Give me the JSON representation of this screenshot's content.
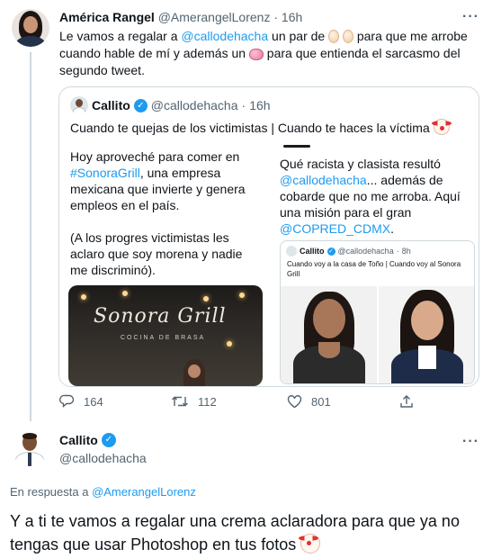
{
  "tweet1": {
    "author_name": "América Rangel",
    "author_handle": "@AmerangelLorenz",
    "separator": "·",
    "time": "16h",
    "text_part1": "Le vamos a regalar a ",
    "mention": "@callodehacha",
    "text_part2": " un par de ",
    "text_part3": " para que me arrobe cuando hable de mí y además un ",
    "text_part4": " para que entienda el sarcasmo del segundo tweet.",
    "more_label": "···",
    "emojis": [
      "egg",
      "egg",
      "brain"
    ]
  },
  "quote": {
    "author_name": "Callito",
    "author_handle": "@callodehacha",
    "separator": "·",
    "time": "16h",
    "text": "Cuando te quejas de los victimistas | Cuando te haces la víctima",
    "left_panel": {
      "para1_part1": "Hoy aproveché para comer en ",
      "para1_hashtag": "#SonoraGrill",
      "para1_part2": ", una empresa mexicana que invierte y genera empleos en el país.",
      "para2": "(A los progres victimistas les aclaro que soy morena y nadie me discriminó).",
      "photo_sign": "Sonora Grill",
      "photo_sub": "COCINA DE BRASA"
    },
    "right_panel": {
      "text_part1": "Qué racista y clasista resultó ",
      "mention1": "@callodehacha",
      "text_part2": "... además de cobarde que no me arroba. Aquí una misión para el gran ",
      "mention2": "@COPRED_CDMX",
      "text_part3": ".",
      "inner_card": {
        "author_name": "Callito",
        "author_handle": "@callodehacha",
        "separator": "·",
        "time": "8h",
        "text": "Cuando voy a la casa de Toño | Cuando voy al Sonora Grill"
      }
    }
  },
  "actions": {
    "replies": "164",
    "retweets": "112",
    "likes": "801"
  },
  "tweet2": {
    "author_name": "Callito",
    "author_handle": "@callodehacha",
    "more_label": "···",
    "reply_prefix": "En respuesta a ",
    "reply_to": "@AmerangelLorenz",
    "text": "Y a ti te vamos a regalar una crema aclaradora para que ya no tengas que usar Photoshop en tus fotos"
  },
  "colors": {
    "accent": "#1d9bf0",
    "text": "#0f1419",
    "muted": "#536471",
    "border": "#cfd9de"
  }
}
